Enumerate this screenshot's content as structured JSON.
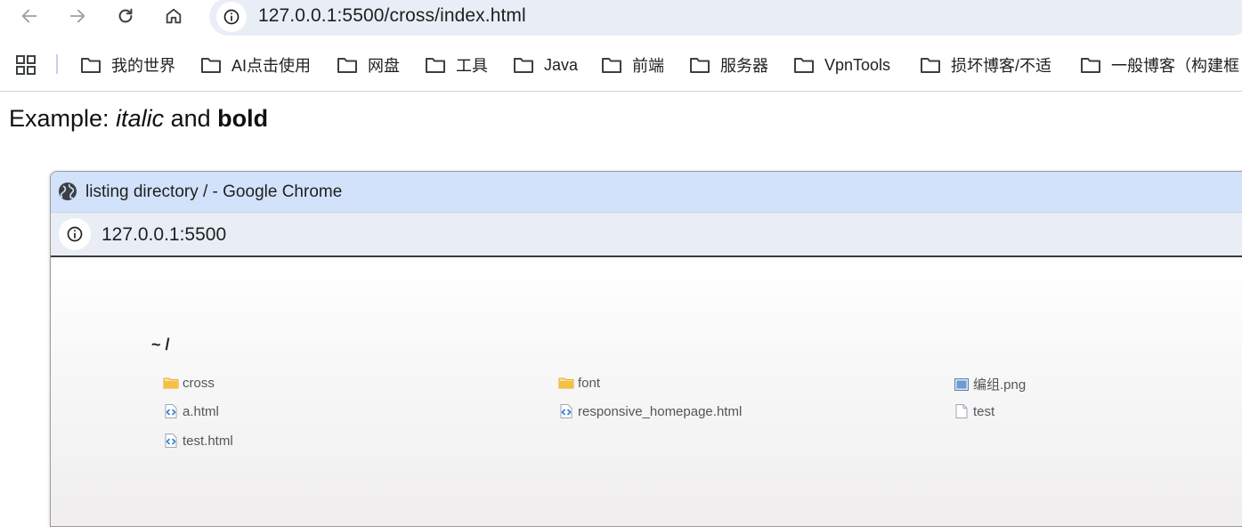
{
  "browser": {
    "url": "127.0.0.1:5500/cross/index.html",
    "nav": {
      "back_icon": "arrow-left-icon",
      "forward_icon": "arrow-right-icon",
      "reload_icon": "reload-icon",
      "home_icon": "home-icon",
      "site_info_icon": "info-icon"
    },
    "bookmarks": [
      {
        "label": "我的世界"
      },
      {
        "label": "AI点击使用"
      },
      {
        "label": "网盘"
      },
      {
        "label": "工具"
      },
      {
        "label": "Java"
      },
      {
        "label": "前端"
      },
      {
        "label": "服务器"
      },
      {
        "label": "VpnTools"
      },
      {
        "label": "损坏博客/不适"
      },
      {
        "label": "一般博客（构建框"
      }
    ]
  },
  "page": {
    "example_prefix": "Example: ",
    "example_italic": "italic",
    "example_and": " and ",
    "example_bold": "bold"
  },
  "popup": {
    "title": "listing directory / - Google Chrome",
    "url": "127.0.0.1:5500",
    "heading": "~ /",
    "files": [
      {
        "name": "cross",
        "type": "folder"
      },
      {
        "name": "font",
        "type": "folder"
      },
      {
        "name": "编组.png",
        "type": "image"
      },
      {
        "name": "a.html",
        "type": "html"
      },
      {
        "name": "responsive_homepage.html",
        "type": "html"
      },
      {
        "name": "test",
        "type": "file"
      },
      {
        "name": "test.html",
        "type": "html"
      }
    ]
  },
  "colors": {
    "omnibox_bg": "#e9eef6",
    "popup_title_bg": "#d3e2fb",
    "folder_icon": "#f5c044",
    "html_icon": "#2f7bd6"
  }
}
